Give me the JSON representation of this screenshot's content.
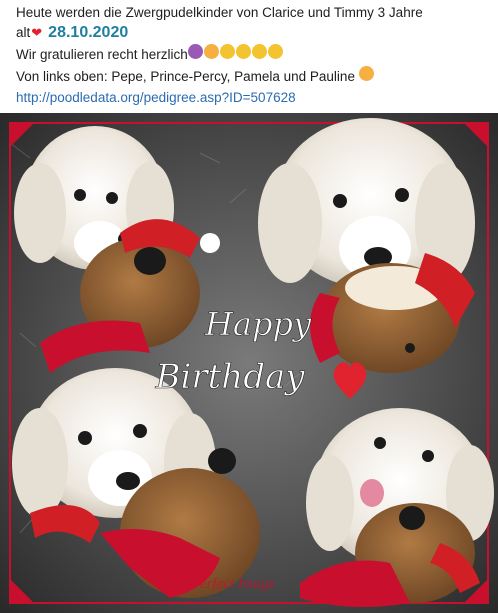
{
  "post": {
    "line1": "Heute werden die Zwergpudelkinder von Clarice und Timmy 3 Jahre",
    "line2_prefix": "alt",
    "date": "28.10.2020",
    "line3": "Wir gratulieren recht herzlich",
    "line4": "Von links oben: Pepe, Prince-Percy, Pamela und Pauline",
    "link": "http://poodledata.org/pedigree.asp?ID=507628"
  },
  "photo": {
    "greeting_word1": "Happy",
    "greeting_word2": "Birthday",
    "watermark": "Perfect Image"
  },
  "colors": {
    "frame": "#c8102e",
    "heart": "#e0232e",
    "date": "#1f7fa0",
    "link": "#2b6cb0"
  }
}
